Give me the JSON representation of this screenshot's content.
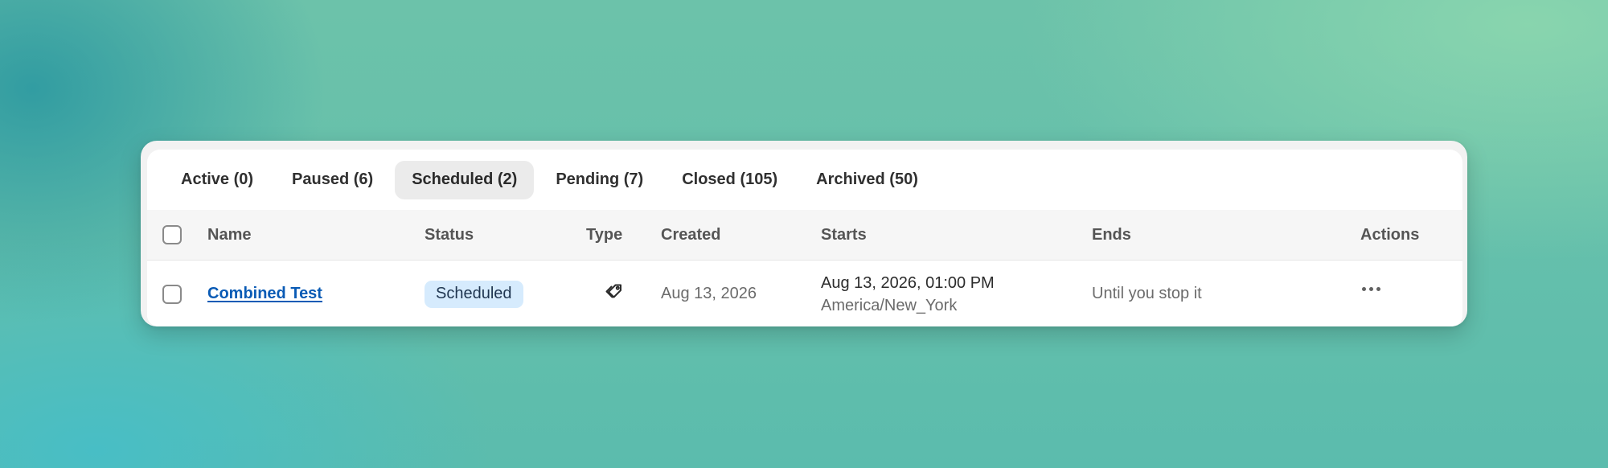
{
  "tabs": [
    {
      "label": "Active (0)",
      "active": false
    },
    {
      "label": "Paused (6)",
      "active": false
    },
    {
      "label": "Scheduled (2)",
      "active": true
    },
    {
      "label": "Pending (7)",
      "active": false
    },
    {
      "label": "Closed (105)",
      "active": false
    },
    {
      "label": "Archived (50)",
      "active": false
    }
  ],
  "table": {
    "columns": {
      "name": "Name",
      "status": "Status",
      "type": "Type",
      "created": "Created",
      "starts": "Starts",
      "ends": "Ends",
      "actions": "Actions"
    },
    "rows": [
      {
        "name": "Combined Test",
        "status": "Scheduled",
        "type_icon": "tags-icon",
        "created": "Aug 13, 2026",
        "starts_datetime": "Aug 13, 2026, 01:00 PM",
        "starts_timezone": "America/New_York",
        "ends": "Until you stop it",
        "actions_icon": "more-horizontal-icon"
      }
    ]
  },
  "colors": {
    "link": "#0a5bb5",
    "status_badge_bg": "#d6ebfd",
    "active_tab_bg": "#ebebeb"
  }
}
